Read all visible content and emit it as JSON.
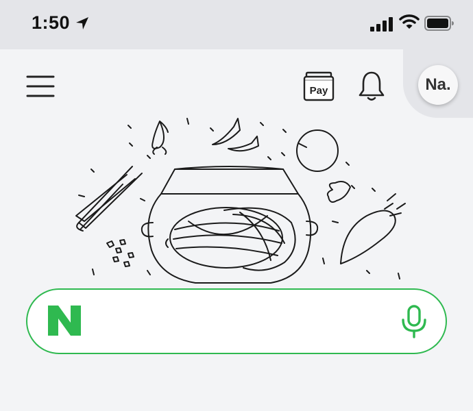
{
  "status_bar": {
    "time": "1:50"
  },
  "header": {
    "pay_label": "Pay",
    "avatar_label": "Na."
  },
  "search": {
    "placeholder": ""
  },
  "colors": {
    "brand_green": "#2fb950",
    "background": "#f3f4f6",
    "status_bar_bg": "#e4e5e9"
  },
  "icons": [
    "location-arrow-icon",
    "signal-icon",
    "wifi-icon",
    "battery-icon",
    "hamburger-menu-icon",
    "pay-icon",
    "bell-icon",
    "naver-logo-icon",
    "microphone-icon"
  ]
}
